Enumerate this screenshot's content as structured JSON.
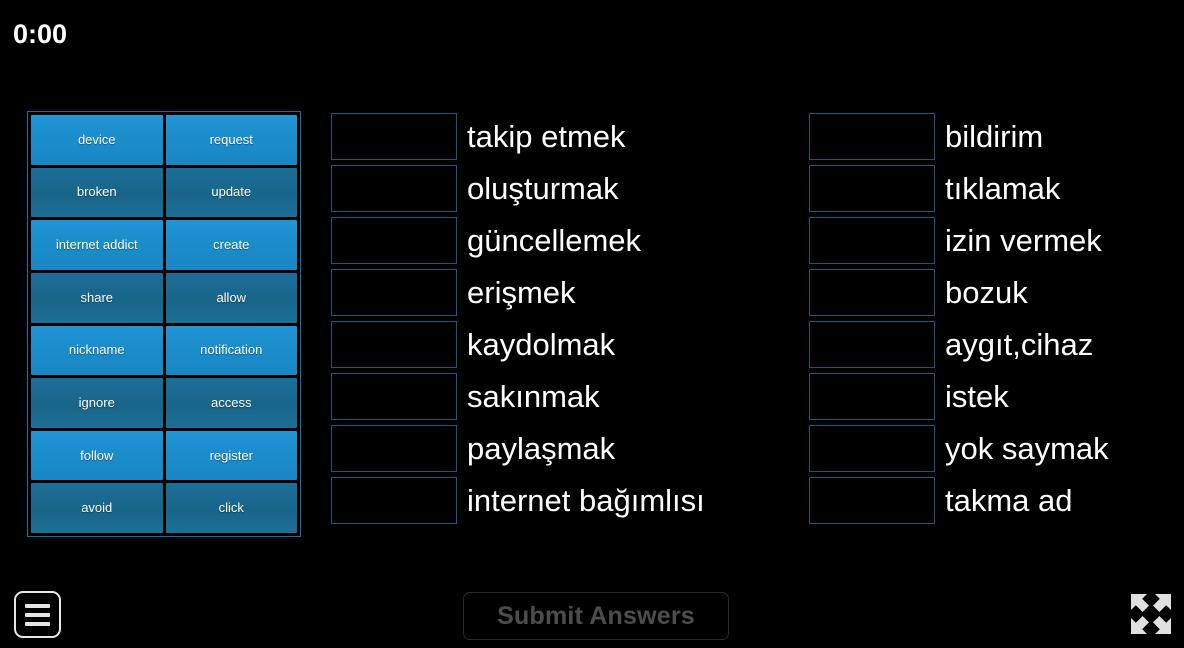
{
  "timer": {
    "value": "0:00"
  },
  "word_bank": {
    "tiles": [
      {
        "label": "device",
        "shade": "light"
      },
      {
        "label": "request",
        "shade": "light"
      },
      {
        "label": "broken",
        "shade": "dark"
      },
      {
        "label": "update",
        "shade": "dark"
      },
      {
        "label": "internet addict",
        "shade": "light"
      },
      {
        "label": "create",
        "shade": "light"
      },
      {
        "label": "share",
        "shade": "dark"
      },
      {
        "label": "allow",
        "shade": "dark"
      },
      {
        "label": "nickname",
        "shade": "light"
      },
      {
        "label": "notification",
        "shade": "light"
      },
      {
        "label": "ignore",
        "shade": "dark"
      },
      {
        "label": "access",
        "shade": "dark"
      },
      {
        "label": "follow",
        "shade": "light"
      },
      {
        "label": "register",
        "shade": "light"
      },
      {
        "label": "avoid",
        "shade": "dark"
      },
      {
        "label": "click",
        "shade": "dark"
      }
    ]
  },
  "answers": {
    "left_column": [
      {
        "prompt": "takip etmek",
        "answer": ""
      },
      {
        "prompt": "oluşturmak",
        "answer": ""
      },
      {
        "prompt": "güncellemek",
        "answer": ""
      },
      {
        "prompt": "erişmek",
        "answer": ""
      },
      {
        "prompt": "kaydolmak",
        "answer": ""
      },
      {
        "prompt": "sakınmak",
        "answer": ""
      },
      {
        "prompt": "paylaşmak",
        "answer": ""
      },
      {
        "prompt": "internet bağımlısı",
        "answer": ""
      }
    ],
    "right_column": [
      {
        "prompt": "bildirim",
        "answer": ""
      },
      {
        "prompt": "tıklamak",
        "answer": ""
      },
      {
        "prompt": "izin vermek",
        "answer": ""
      },
      {
        "prompt": "bozuk",
        "answer": ""
      },
      {
        "prompt": "aygıt,cihaz",
        "answer": ""
      },
      {
        "prompt": "istek",
        "answer": ""
      },
      {
        "prompt": "yok saymak",
        "answer": ""
      },
      {
        "prompt": "takma ad",
        "answer": ""
      }
    ]
  },
  "footer": {
    "menu_icon": "hamburger-menu-icon",
    "submit_label": "Submit Answers",
    "fullscreen_icon": "fullscreen-expand-icon"
  },
  "colors": {
    "background": "#000000",
    "tile_light": "#1b8cca",
    "tile_dark": "#196589",
    "panel_border": "#1d6fa0",
    "slot_border": "#1e5778",
    "text": "#ffffff",
    "submit_text": "#4d4d4d"
  }
}
